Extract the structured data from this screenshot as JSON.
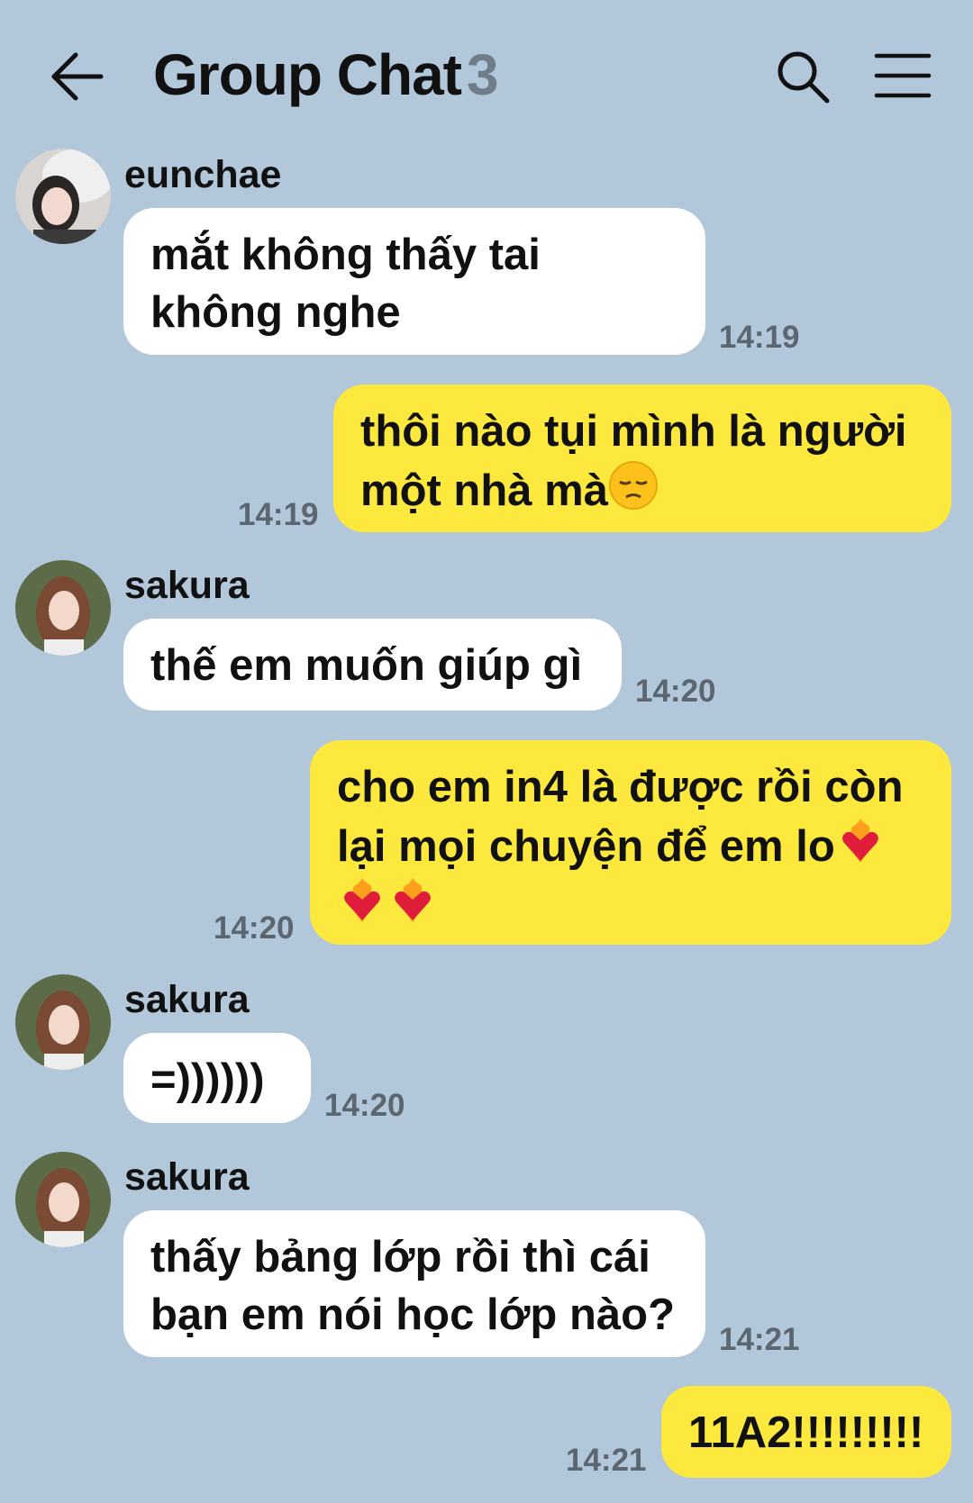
{
  "header": {
    "title": "Group Chat",
    "member_count": "3",
    "back_icon": "arrow-left-icon",
    "search_icon": "search-icon",
    "menu_icon": "hamburger-menu-icon"
  },
  "colors": {
    "background": "#b2c7da",
    "incoming_bubble": "#ffffff",
    "outgoing_bubble": "#fde83d",
    "timestamp": "#5c6670"
  },
  "messages": [
    {
      "direction": "in",
      "sender": "eunchae",
      "lines": [
        "mắt không thấy tai",
        "không nghe"
      ],
      "time": "14:19"
    },
    {
      "direction": "out",
      "lines": [
        "thôi nào tụi mình là người",
        "một nhà mà"
      ],
      "emoji_after": "pensive-face-emoji",
      "time": "14:19"
    },
    {
      "direction": "in",
      "sender": "sakura",
      "lines": [
        "thế em muốn giúp gì"
      ],
      "time": "14:20"
    },
    {
      "direction": "out",
      "lines": [
        "cho em in4 là được rồi còn",
        "lại mọi chuyện để em lo"
      ],
      "emoji_after": "heart-on-fire-emoji",
      "emoji_line3": [
        "heart-on-fire-emoji",
        "heart-on-fire-emoji"
      ],
      "time": "14:20"
    },
    {
      "direction": "in",
      "sender": "sakura",
      "lines": [
        "=))))))"
      ],
      "time": "14:20"
    },
    {
      "direction": "in",
      "sender": "sakura",
      "lines": [
        "thấy bảng lớp rồi thì cái",
        "bạn em nói học lớp nào?"
      ],
      "time": "14:21"
    },
    {
      "direction": "out",
      "lines": [
        "11A2!!!!!!!!!"
      ],
      "time": "14:21"
    }
  ]
}
